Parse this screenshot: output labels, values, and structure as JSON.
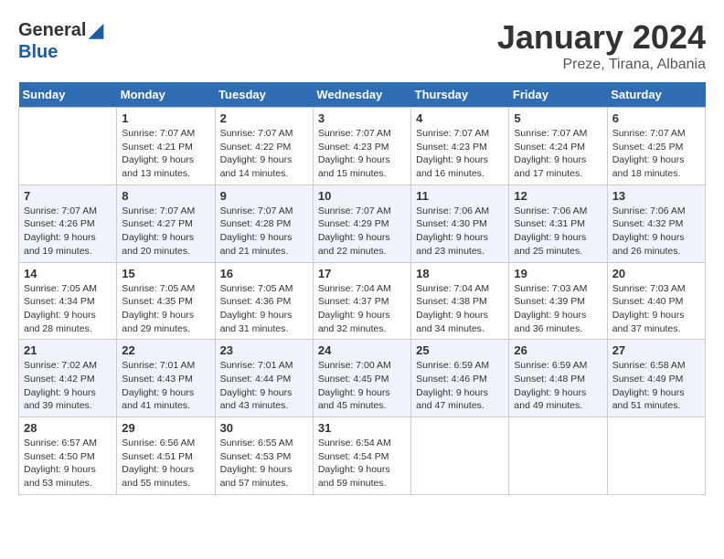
{
  "header": {
    "logo_general": "General",
    "logo_blue": "Blue",
    "month_title": "January 2024",
    "location": "Preze, Tirana, Albania"
  },
  "weekdays": [
    "Sunday",
    "Monday",
    "Tuesday",
    "Wednesday",
    "Thursday",
    "Friday",
    "Saturday"
  ],
  "weeks": [
    [
      {
        "day": "",
        "sunrise": "",
        "sunset": "",
        "daylight": ""
      },
      {
        "day": "1",
        "sunrise": "Sunrise: 7:07 AM",
        "sunset": "Sunset: 4:21 PM",
        "daylight": "Daylight: 9 hours and 13 minutes."
      },
      {
        "day": "2",
        "sunrise": "Sunrise: 7:07 AM",
        "sunset": "Sunset: 4:22 PM",
        "daylight": "Daylight: 9 hours and 14 minutes."
      },
      {
        "day": "3",
        "sunrise": "Sunrise: 7:07 AM",
        "sunset": "Sunset: 4:23 PM",
        "daylight": "Daylight: 9 hours and 15 minutes."
      },
      {
        "day": "4",
        "sunrise": "Sunrise: 7:07 AM",
        "sunset": "Sunset: 4:23 PM",
        "daylight": "Daylight: 9 hours and 16 minutes."
      },
      {
        "day": "5",
        "sunrise": "Sunrise: 7:07 AM",
        "sunset": "Sunset: 4:24 PM",
        "daylight": "Daylight: 9 hours and 17 minutes."
      },
      {
        "day": "6",
        "sunrise": "Sunrise: 7:07 AM",
        "sunset": "Sunset: 4:25 PM",
        "daylight": "Daylight: 9 hours and 18 minutes."
      }
    ],
    [
      {
        "day": "7",
        "sunrise": "Sunrise: 7:07 AM",
        "sunset": "Sunset: 4:26 PM",
        "daylight": "Daylight: 9 hours and 19 minutes."
      },
      {
        "day": "8",
        "sunrise": "Sunrise: 7:07 AM",
        "sunset": "Sunset: 4:27 PM",
        "daylight": "Daylight: 9 hours and 20 minutes."
      },
      {
        "day": "9",
        "sunrise": "Sunrise: 7:07 AM",
        "sunset": "Sunset: 4:28 PM",
        "daylight": "Daylight: 9 hours and 21 minutes."
      },
      {
        "day": "10",
        "sunrise": "Sunrise: 7:07 AM",
        "sunset": "Sunset: 4:29 PM",
        "daylight": "Daylight: 9 hours and 22 minutes."
      },
      {
        "day": "11",
        "sunrise": "Sunrise: 7:06 AM",
        "sunset": "Sunset: 4:30 PM",
        "daylight": "Daylight: 9 hours and 23 minutes."
      },
      {
        "day": "12",
        "sunrise": "Sunrise: 7:06 AM",
        "sunset": "Sunset: 4:31 PM",
        "daylight": "Daylight: 9 hours and 25 minutes."
      },
      {
        "day": "13",
        "sunrise": "Sunrise: 7:06 AM",
        "sunset": "Sunset: 4:32 PM",
        "daylight": "Daylight: 9 hours and 26 minutes."
      }
    ],
    [
      {
        "day": "14",
        "sunrise": "Sunrise: 7:05 AM",
        "sunset": "Sunset: 4:34 PM",
        "daylight": "Daylight: 9 hours and 28 minutes."
      },
      {
        "day": "15",
        "sunrise": "Sunrise: 7:05 AM",
        "sunset": "Sunset: 4:35 PM",
        "daylight": "Daylight: 9 hours and 29 minutes."
      },
      {
        "day": "16",
        "sunrise": "Sunrise: 7:05 AM",
        "sunset": "Sunset: 4:36 PM",
        "daylight": "Daylight: 9 hours and 31 minutes."
      },
      {
        "day": "17",
        "sunrise": "Sunrise: 7:04 AM",
        "sunset": "Sunset: 4:37 PM",
        "daylight": "Daylight: 9 hours and 32 minutes."
      },
      {
        "day": "18",
        "sunrise": "Sunrise: 7:04 AM",
        "sunset": "Sunset: 4:38 PM",
        "daylight": "Daylight: 9 hours and 34 minutes."
      },
      {
        "day": "19",
        "sunrise": "Sunrise: 7:03 AM",
        "sunset": "Sunset: 4:39 PM",
        "daylight": "Daylight: 9 hours and 36 minutes."
      },
      {
        "day": "20",
        "sunrise": "Sunrise: 7:03 AM",
        "sunset": "Sunset: 4:40 PM",
        "daylight": "Daylight: 9 hours and 37 minutes."
      }
    ],
    [
      {
        "day": "21",
        "sunrise": "Sunrise: 7:02 AM",
        "sunset": "Sunset: 4:42 PM",
        "daylight": "Daylight: 9 hours and 39 minutes."
      },
      {
        "day": "22",
        "sunrise": "Sunrise: 7:01 AM",
        "sunset": "Sunset: 4:43 PM",
        "daylight": "Daylight: 9 hours and 41 minutes."
      },
      {
        "day": "23",
        "sunrise": "Sunrise: 7:01 AM",
        "sunset": "Sunset: 4:44 PM",
        "daylight": "Daylight: 9 hours and 43 minutes."
      },
      {
        "day": "24",
        "sunrise": "Sunrise: 7:00 AM",
        "sunset": "Sunset: 4:45 PM",
        "daylight": "Daylight: 9 hours and 45 minutes."
      },
      {
        "day": "25",
        "sunrise": "Sunrise: 6:59 AM",
        "sunset": "Sunset: 4:46 PM",
        "daylight": "Daylight: 9 hours and 47 minutes."
      },
      {
        "day": "26",
        "sunrise": "Sunrise: 6:59 AM",
        "sunset": "Sunset: 4:48 PM",
        "daylight": "Daylight: 9 hours and 49 minutes."
      },
      {
        "day": "27",
        "sunrise": "Sunrise: 6:58 AM",
        "sunset": "Sunset: 4:49 PM",
        "daylight": "Daylight: 9 hours and 51 minutes."
      }
    ],
    [
      {
        "day": "28",
        "sunrise": "Sunrise: 6:57 AM",
        "sunset": "Sunset: 4:50 PM",
        "daylight": "Daylight: 9 hours and 53 minutes."
      },
      {
        "day": "29",
        "sunrise": "Sunrise: 6:56 AM",
        "sunset": "Sunset: 4:51 PM",
        "daylight": "Daylight: 9 hours and 55 minutes."
      },
      {
        "day": "30",
        "sunrise": "Sunrise: 6:55 AM",
        "sunset": "Sunset: 4:53 PM",
        "daylight": "Daylight: 9 hours and 57 minutes."
      },
      {
        "day": "31",
        "sunrise": "Sunrise: 6:54 AM",
        "sunset": "Sunset: 4:54 PM",
        "daylight": "Daylight: 9 hours and 59 minutes."
      },
      {
        "day": "",
        "sunrise": "",
        "sunset": "",
        "daylight": ""
      },
      {
        "day": "",
        "sunrise": "",
        "sunset": "",
        "daylight": ""
      },
      {
        "day": "",
        "sunrise": "",
        "sunset": "",
        "daylight": ""
      }
    ]
  ]
}
